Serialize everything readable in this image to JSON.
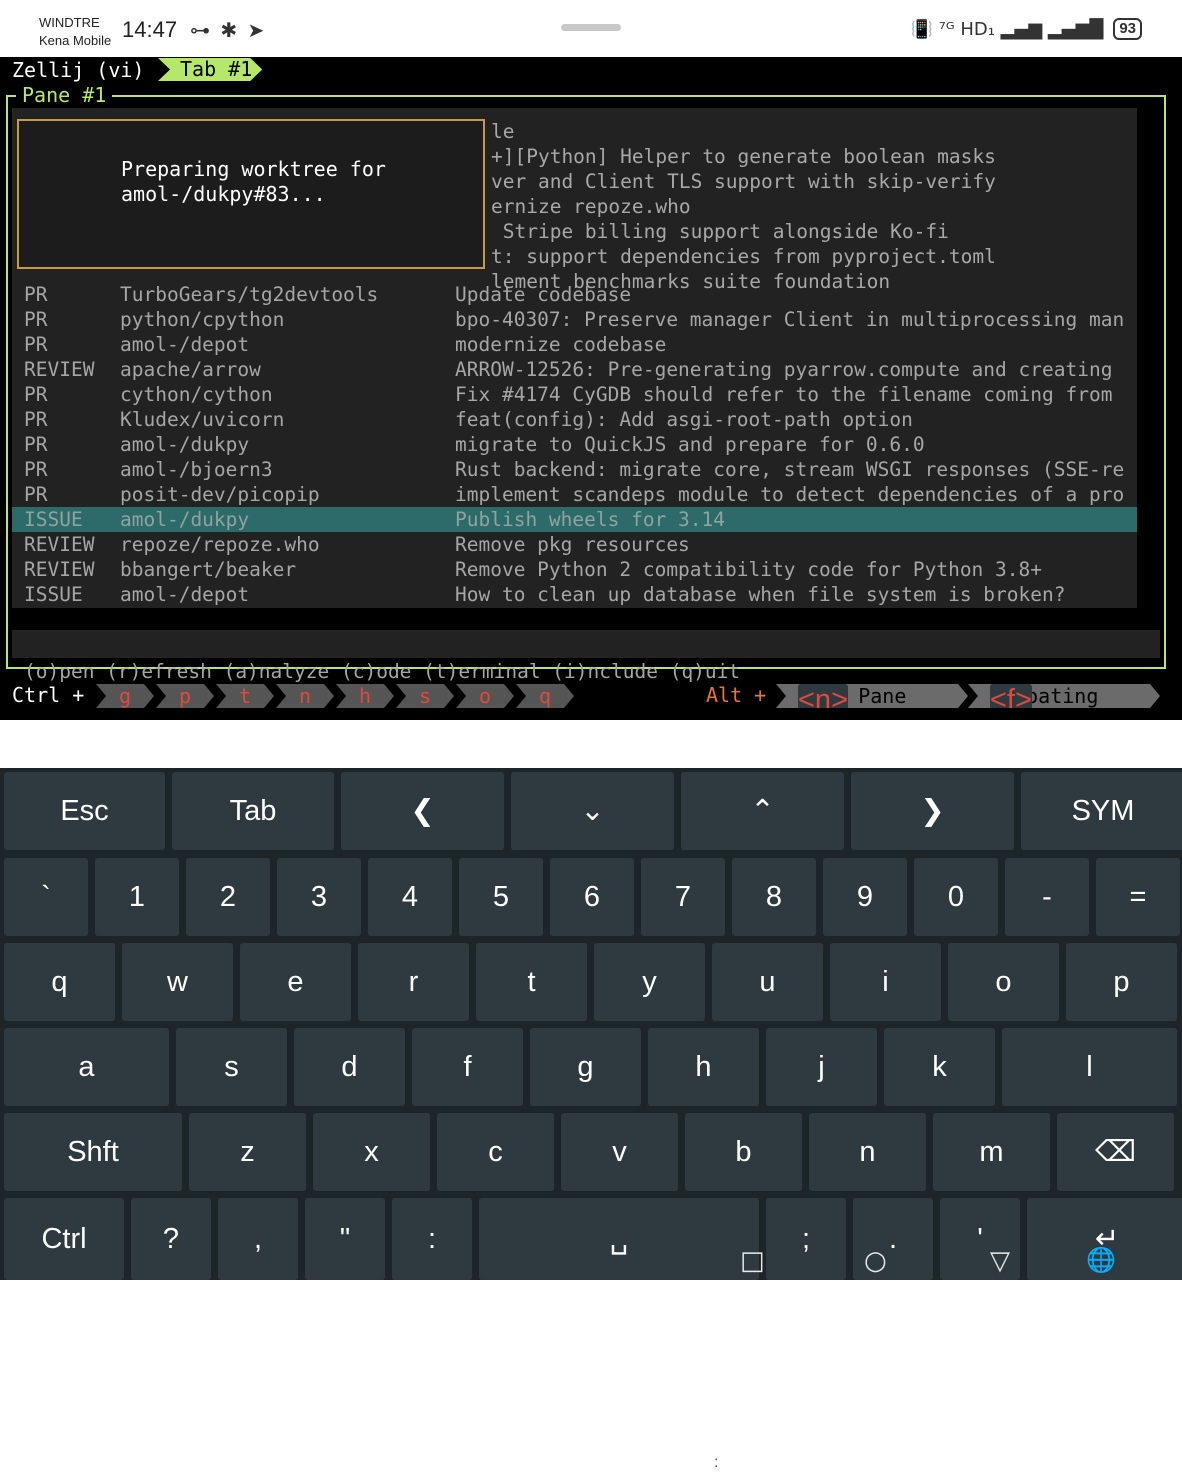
{
  "status_bar": {
    "carrier1": "WINDTRE",
    "carrier2": "Kena Mobile",
    "time": "14:47",
    "left_icons": "⊶ ✱ ➤",
    "right_icons": "📳 ⁷ᴳ HD₁ ▂▄▆ ▂▄▆█",
    "battery": "93"
  },
  "zellij": {
    "app_title": "Zellij (vi)",
    "tab": "Tab #1",
    "pane_title": "Pane #1",
    "popup_text": "Preparing worktree for\namol-/dukpy#83...",
    "background_lines": [
      "le",
      "+][Python] Helper to generate boolean masks",
      "ver and Client TLS support with skip-verify",
      "ernize repoze.who",
      " Stripe billing support alongside Ko-fi",
      "t: support dependencies from pyproject.toml",
      "lement benchmarks suite foundation"
    ],
    "rows": [
      {
        "type": "PR",
        "repo": "TurboGears/tg2devtools",
        "title": "Update codebase"
      },
      {
        "type": "PR",
        "repo": "python/cpython",
        "title": "bpo-40307: Preserve manager Client in multiprocessing man"
      },
      {
        "type": "PR",
        "repo": "amol-/depot",
        "title": "modernize codebase"
      },
      {
        "type": "REVIEW",
        "repo": "apache/arrow",
        "title": "ARROW-12526: Pre-generating pyarrow.compute and creating"
      },
      {
        "type": "PR",
        "repo": "cython/cython",
        "title": "Fix #4174 CyGDB should refer to the filename coming from"
      },
      {
        "type": "PR",
        "repo": "Kludex/uvicorn",
        "title": "feat(config): Add asgi-root-path option"
      },
      {
        "type": "PR",
        "repo": "amol-/dukpy",
        "title": "migrate to QuickJS and prepare for 0.6.0"
      },
      {
        "type": "PR",
        "repo": "amol-/bjoern3",
        "title": "Rust backend: migrate core, stream WSGI responses (SSE-re"
      },
      {
        "type": "PR",
        "repo": "posit-dev/picopip",
        "title": "implement scandeps module to detect dependencies of a pro"
      },
      {
        "type": "ISSUE",
        "repo": "amol-/dukpy",
        "title": "Publish wheels for 3.14"
      },
      {
        "type": "REVIEW",
        "repo": "repoze/repoze.who",
        "title": "Remove pkg resources"
      },
      {
        "type": "REVIEW",
        "repo": "bbangert/beaker",
        "title": "Remove Python 2 compatibility code for Python 3.8+"
      },
      {
        "type": "ISSUE",
        "repo": "amol-/depot",
        "title": "How to clean up database when file system is broken?"
      }
    ],
    "selected_index": 9,
    "help_line": "(o)pen (r)efresh (a)nalyze (c)ode (t)erminal (i)nclude (q)uit",
    "ctrl_label": "Ctrl +",
    "ctrl_keys": [
      "g",
      "p",
      "t",
      "n",
      "h",
      "s",
      "o",
      "q"
    ],
    "alt_label": "Alt +",
    "alt_modes": [
      {
        "key": "<n>",
        "label": " New Pane"
      },
      {
        "key": "<f>",
        "label": " Floating"
      }
    ]
  },
  "separator_dots": ":",
  "keyboard": {
    "row1": [
      "Esc",
      "Tab",
      "❮",
      "⌄",
      "⌃",
      "❯",
      "SYM"
    ],
    "row2": [
      "`",
      "1",
      "2",
      "3",
      "4",
      "5",
      "6",
      "7",
      "8",
      "9",
      "0",
      "-",
      "="
    ],
    "row3": [
      "q",
      "w",
      "e",
      "r",
      "t",
      "y",
      "u",
      "i",
      "o",
      "p"
    ],
    "row4": [
      "a",
      "s",
      "d",
      "f",
      "g",
      "h",
      "j",
      "k",
      "l"
    ],
    "row5": [
      "Shft",
      "z",
      "x",
      "c",
      "v",
      "b",
      "n",
      "m",
      "⌫"
    ],
    "row6": [
      "Ctrl",
      "?",
      ",",
      "\"",
      ":",
      "␣",
      ";",
      ".",
      "'",
      "↵"
    ]
  },
  "navbar": {
    "recent": "□",
    "home": "○",
    "back": "▽",
    "globe": "🌐"
  }
}
